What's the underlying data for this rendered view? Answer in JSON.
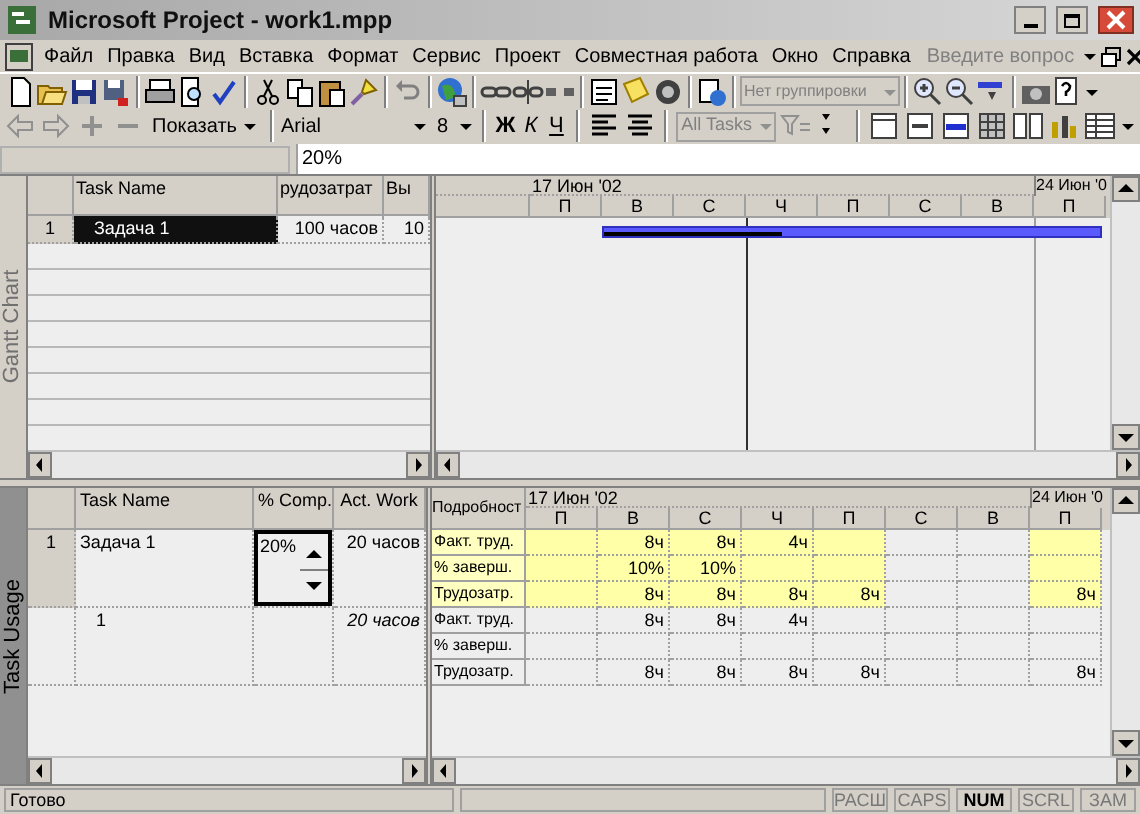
{
  "window": {
    "title": "Microsoft Project - work1.mpp"
  },
  "menu": {
    "items": [
      "Файл",
      "Правка",
      "Вид",
      "Вставка",
      "Формат",
      "Сервис",
      "Проект",
      "Совместная работа",
      "Окно",
      "Справка"
    ],
    "help_box": {
      "placeholder": "Введите вопрос"
    }
  },
  "standard_toolbar": {
    "group_box": {
      "value": "Нет группировки",
      "disabled": true
    }
  },
  "formatting_toolbar": {
    "show_button": "Показать",
    "font": "Arial",
    "size": "8",
    "style_buttons": [
      "Ж",
      "К",
      "Ч"
    ],
    "filter_box": {
      "value": "All Tasks",
      "disabled": true
    }
  },
  "entry_bar": {
    "value": "20%"
  },
  "gantt_view": {
    "side_label": "Gantt Chart",
    "active": false,
    "columns": [
      "Task Name",
      "рудозатрат",
      "Вы"
    ],
    "rows": [
      {
        "id": "1",
        "cells": [
          "Задача 1",
          "100 часов",
          "10"
        ],
        "selected": true
      }
    ],
    "timescale": {
      "weeks": [
        "17 Июн '02",
        "24 Июн '0"
      ],
      "days": [
        {
          "label": "П",
          "current": false
        },
        {
          "label": "В",
          "current": false
        },
        {
          "label": "С",
          "current": false
        },
        {
          "label": "Ч",
          "current": true
        },
        {
          "label": "П",
          "current": false
        },
        {
          "label": "С",
          "current": false
        },
        {
          "label": "В",
          "current": false
        },
        {
          "label": "П",
          "current": false
        }
      ]
    },
    "progress": {
      "level": 0.36
    }
  },
  "usage_view": {
    "side_label": "Task Usage",
    "active": true,
    "columns": [
      "Task Name",
      "% Comp.",
      "Act. Work"
    ],
    "details_header": "Подробност",
    "timescale": {
      "weeks": [
        "17 Июн '02",
        "24 Июн '0"
      ],
      "days": [
        {
          "label": "П",
          "working": true
        },
        {
          "label": "В",
          "working": true
        },
        {
          "label": "С",
          "working": true
        },
        {
          "label": "Ч",
          "working": true
        },
        {
          "label": "П",
          "working": true
        },
        {
          "label": "С",
          "working": false
        },
        {
          "label": "В",
          "working": false
        },
        {
          "label": "П",
          "working": true
        }
      ]
    },
    "rows": [
      {
        "kind": "task",
        "id": "1",
        "name": "Задача 1",
        "comp": "20%",
        "editing": true,
        "work": "20 часов",
        "details": [
          {
            "label": "Факт. труд.",
            "cells": [
              {},
              {
                "value": "8ч"
              },
              {
                "value": "8ч"
              },
              {
                "value": "4ч"
              },
              {},
              {},
              {},
              {}
            ]
          },
          {
            "label": "% заверш.",
            "cells": [
              {},
              {
                "value": "10%"
              },
              {
                "value": "10%"
              },
              {},
              {},
              {},
              {},
              {}
            ]
          },
          {
            "label": "Трудозатр.",
            "cells": [
              {},
              {
                "value": "8ч"
              },
              {
                "value": "8ч"
              },
              {
                "value": "8ч"
              },
              {
                "value": "8ч"
              },
              {},
              {},
              {
                "value": "8ч"
              }
            ]
          }
        ]
      },
      {
        "kind": "assignment",
        "name": "1",
        "editing": false,
        "work": "20 часов",
        "details": [
          {
            "label": "Факт. труд.",
            "cells": [
              {},
              {
                "value": "8ч"
              },
              {
                "value": "8ч"
              },
              {
                "value": "4ч"
              },
              {},
              {},
              {},
              {}
            ]
          },
          {
            "label": "% заверш.",
            "cells": [
              {},
              {},
              {},
              {},
              {},
              {},
              {},
              {}
            ]
          },
          {
            "label": "Трудозатр.",
            "cells": [
              {},
              {
                "value": "8ч"
              },
              {
                "value": "8ч"
              },
              {
                "value": "8ч"
              },
              {
                "value": "8ч"
              },
              {},
              {},
              {
                "value": "8ч"
              }
            ]
          }
        ]
      }
    ]
  },
  "status_bar": {
    "text": "Готово",
    "indicators": [
      {
        "label": "РАСШ",
        "on": false
      },
      {
        "label": "CAPS",
        "on": false
      },
      {
        "label": "NUM",
        "on": true
      },
      {
        "label": "SCRL",
        "on": false
      },
      {
        "label": "ЗАМ",
        "on": false
      }
    ]
  }
}
